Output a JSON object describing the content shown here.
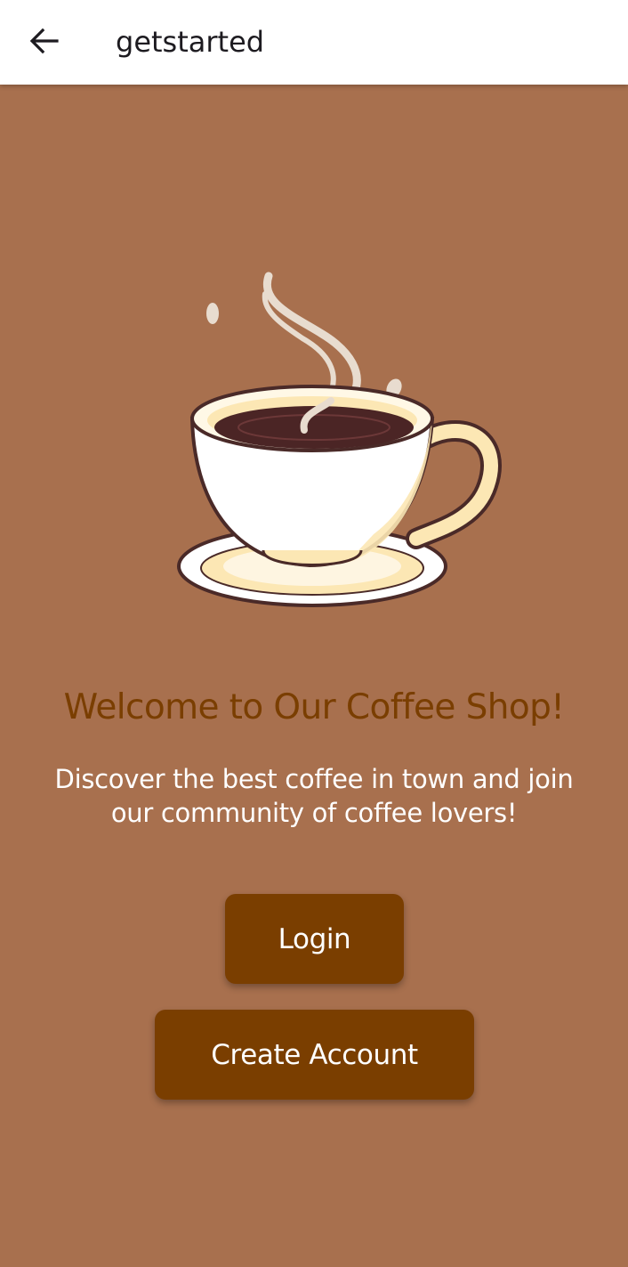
{
  "appbar": {
    "title": "getstarted",
    "back_icon": "arrow-left-icon"
  },
  "hero": {
    "image": "coffee-cup-illustration"
  },
  "welcome": {
    "title": "Welcome to Our Coffee Shop!",
    "description": "Discover the best coffee in town and join our community of coffee lovers!"
  },
  "actions": {
    "login_label": "Login",
    "create_account_label": "Create Account"
  },
  "colors": {
    "background": "#A8704E",
    "title": "#7A3E00",
    "button": "#7A3E00",
    "button_text": "#FFFFFF",
    "appbar": "#FFFFFF"
  }
}
